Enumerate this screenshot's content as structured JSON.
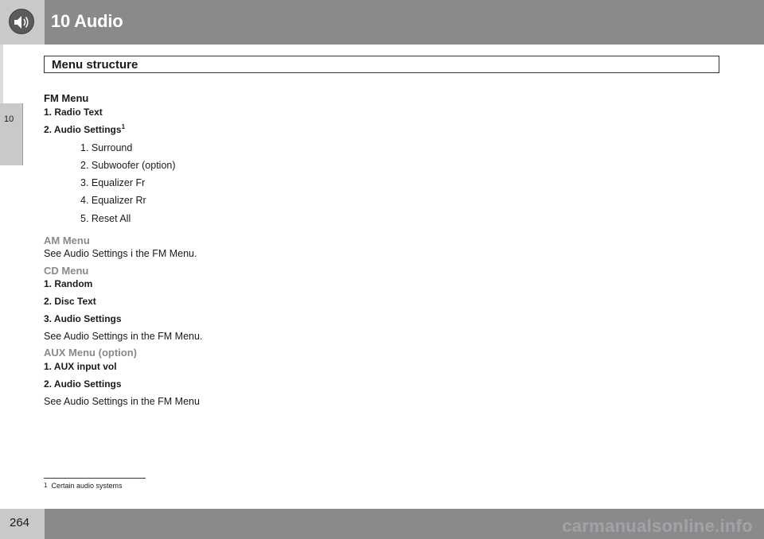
{
  "header": {
    "chapter_title": "10 Audio",
    "section_title": "Menu structure",
    "chapter_icon": "speaker-icon"
  },
  "side_tab": {
    "label": "10"
  },
  "fm_menu": {
    "heading": "FM Menu",
    "item1": "1. Radio Text",
    "item2": "2. Audio Settings",
    "item2_footnote": "1",
    "subitems": [
      "1. Surround",
      "2. Subwoofer (option)",
      "3. Equalizer Fr",
      "4. Equalizer Rr",
      "5. Reset All"
    ]
  },
  "am_menu": {
    "heading": "AM Menu",
    "text": "See Audio Settings i the FM Menu."
  },
  "cd_menu": {
    "heading": "CD Menu",
    "items": [
      "1. Random",
      "2. Disc Text",
      "3. Audio Settings"
    ],
    "text": "See Audio Settings in the FM Menu."
  },
  "aux_menu": {
    "heading": "AUX Menu (option)",
    "items": [
      "1. AUX input vol",
      "2. Audio Settings"
    ],
    "text": "See Audio Settings in the FM Menu"
  },
  "footnote": {
    "number": "1",
    "text": "Certain audio systems"
  },
  "footer": {
    "page_number": "264",
    "watermark": "carmanualsonline.info"
  },
  "colors": {
    "header_gray": "#8a8a8d",
    "light_gray": "#c9c9cb",
    "subheading_gray": "#8a8a8d"
  }
}
